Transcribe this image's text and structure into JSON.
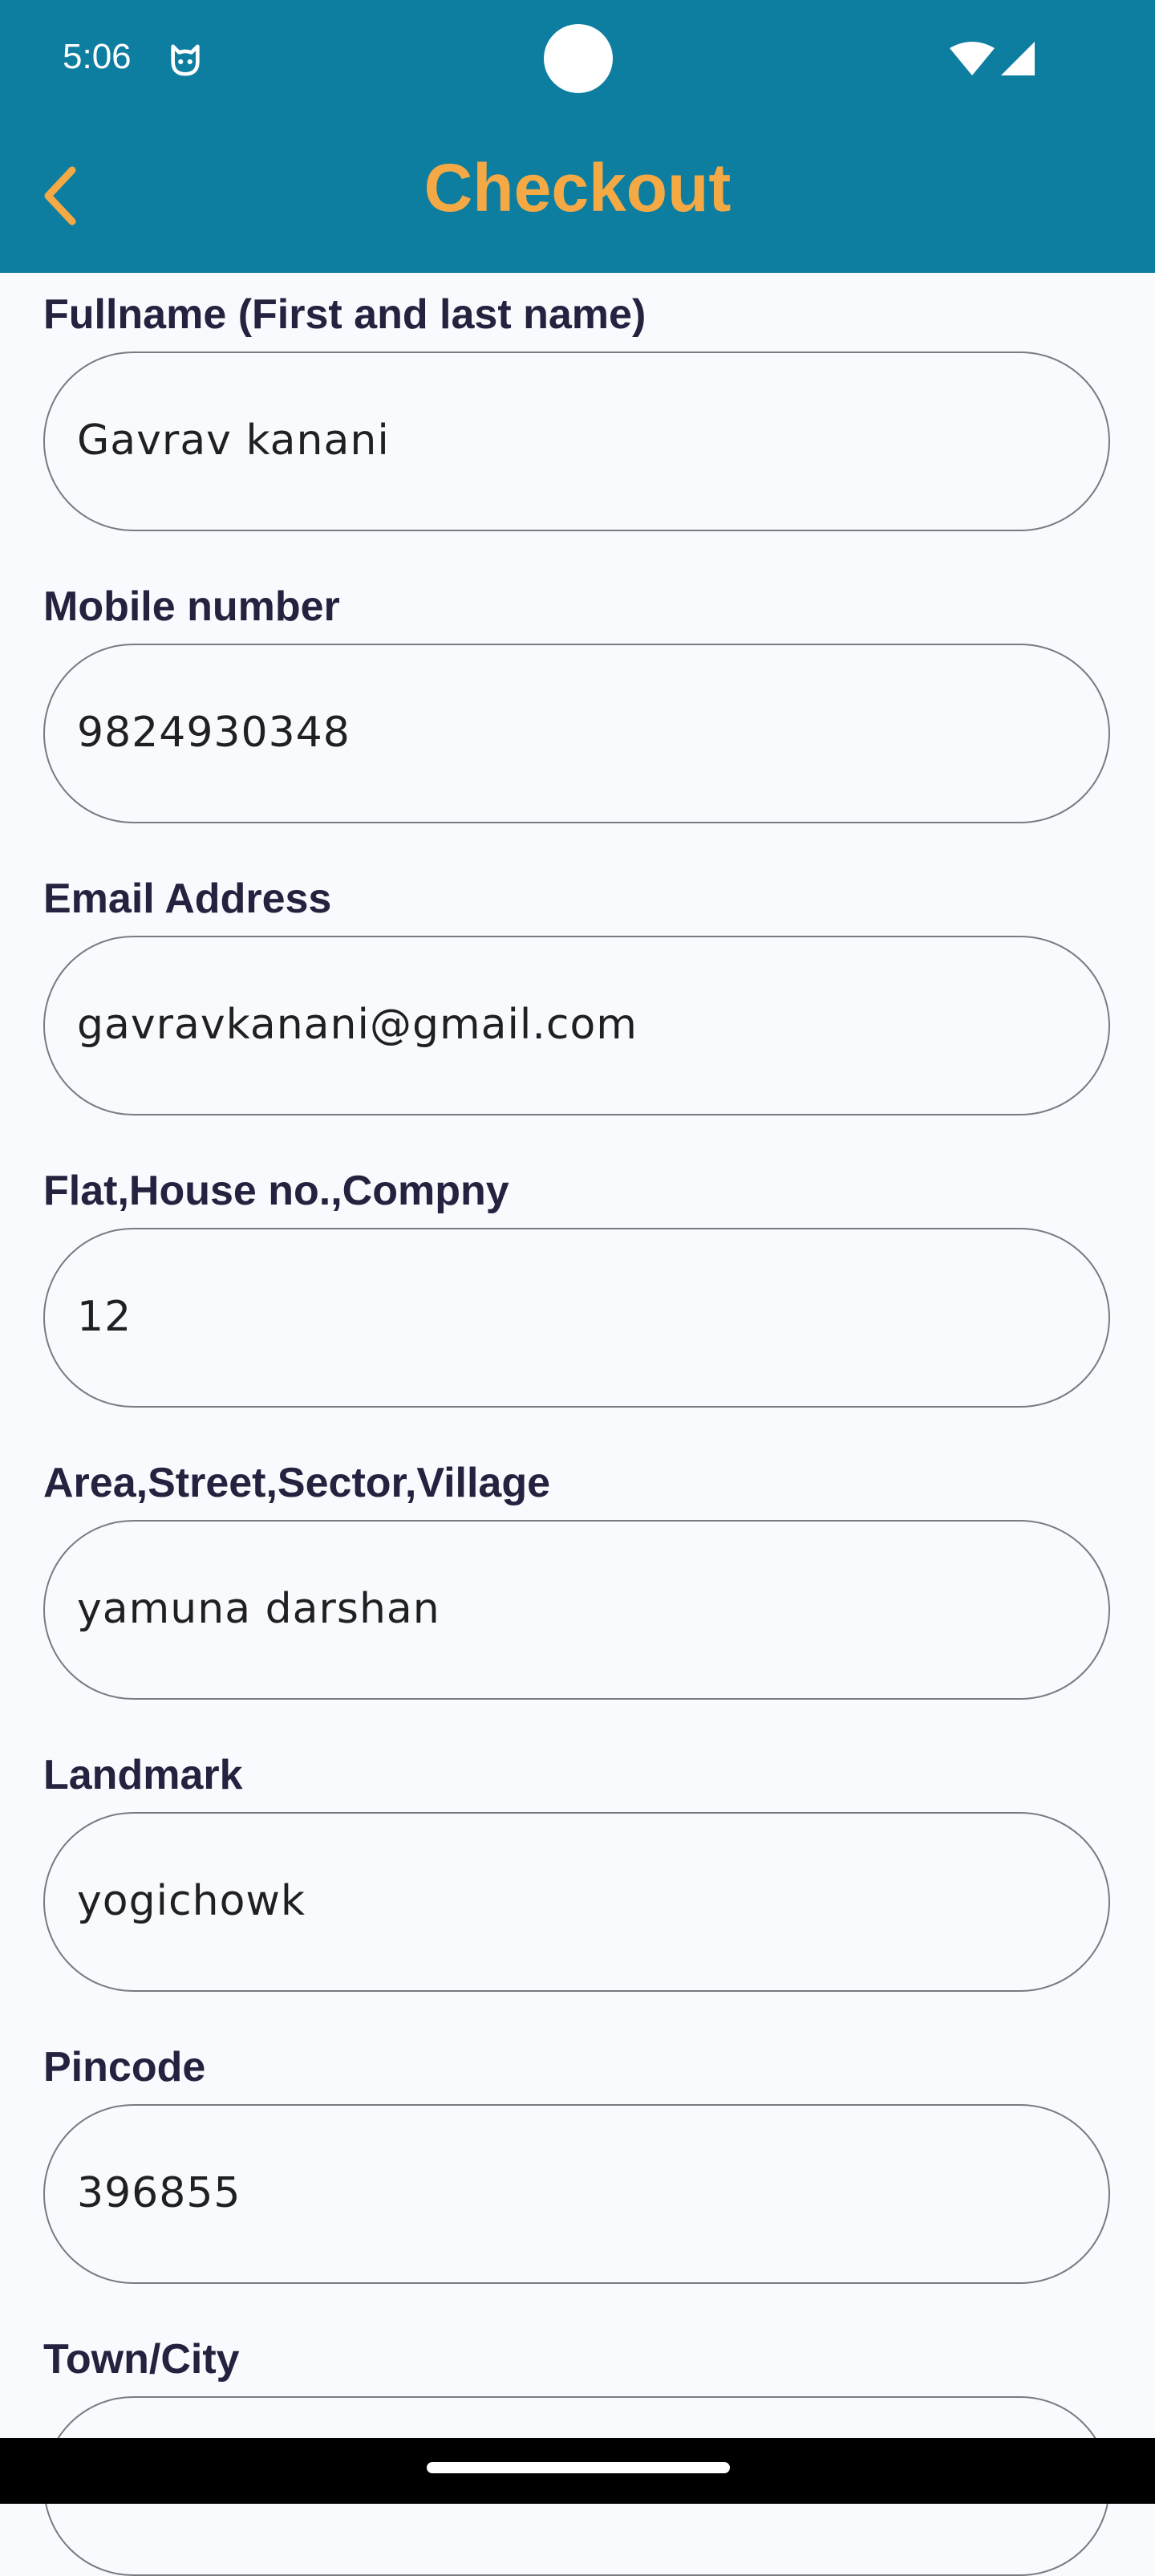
{
  "status_bar": {
    "time": "5:06",
    "icons": [
      "cat-face-icon",
      "wifi-icon",
      "signal-icon"
    ]
  },
  "header": {
    "title": "Checkout",
    "back_icon": "chevron-left-icon",
    "background_color": "#0e7ea0",
    "title_color": "#f5a944"
  },
  "form": {
    "fields": [
      {
        "label": "Fullname (First and last name)",
        "value": "Gavrav kanani"
      },
      {
        "label": "Mobile number",
        "value": "9824930348"
      },
      {
        "label": "Email Address",
        "value": "gavravkanani@gmail.com"
      },
      {
        "label": "Flat,House no.,Compny",
        "value": "12"
      },
      {
        "label": "Area,Street,Sector,Village",
        "value": "yamuna darshan"
      },
      {
        "label": "Landmark",
        "value": "yogichowk"
      },
      {
        "label": "Pincode",
        "value": "396855"
      },
      {
        "label": "Town/City",
        "value": ""
      }
    ]
  }
}
